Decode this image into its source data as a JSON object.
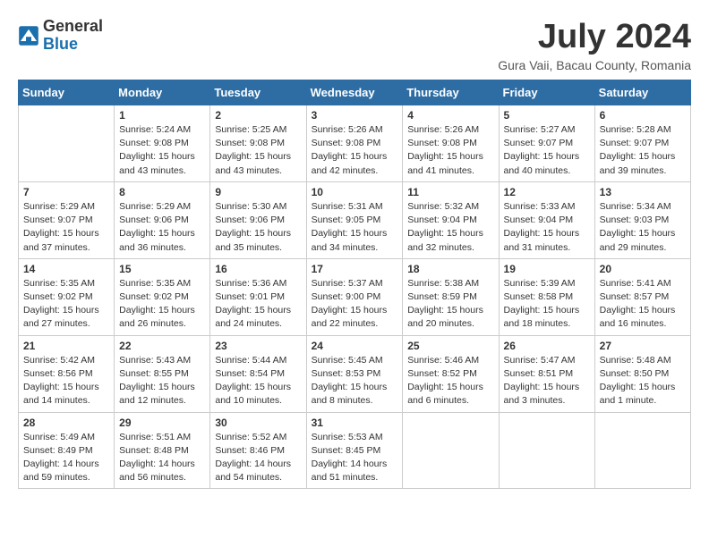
{
  "header": {
    "logo_general": "General",
    "logo_blue": "Blue",
    "month_title": "July 2024",
    "location": "Gura Vaii, Bacau County, Romania"
  },
  "weekdays": [
    "Sunday",
    "Monday",
    "Tuesday",
    "Wednesday",
    "Thursday",
    "Friday",
    "Saturday"
  ],
  "weeks": [
    [
      {
        "day": null,
        "info": null
      },
      {
        "day": "1",
        "info": "Sunrise: 5:24 AM\nSunset: 9:08 PM\nDaylight: 15 hours\nand 43 minutes."
      },
      {
        "day": "2",
        "info": "Sunrise: 5:25 AM\nSunset: 9:08 PM\nDaylight: 15 hours\nand 43 minutes."
      },
      {
        "day": "3",
        "info": "Sunrise: 5:26 AM\nSunset: 9:08 PM\nDaylight: 15 hours\nand 42 minutes."
      },
      {
        "day": "4",
        "info": "Sunrise: 5:26 AM\nSunset: 9:08 PM\nDaylight: 15 hours\nand 41 minutes."
      },
      {
        "day": "5",
        "info": "Sunrise: 5:27 AM\nSunset: 9:07 PM\nDaylight: 15 hours\nand 40 minutes."
      },
      {
        "day": "6",
        "info": "Sunrise: 5:28 AM\nSunset: 9:07 PM\nDaylight: 15 hours\nand 39 minutes."
      }
    ],
    [
      {
        "day": "7",
        "info": "Sunrise: 5:29 AM\nSunset: 9:07 PM\nDaylight: 15 hours\nand 37 minutes."
      },
      {
        "day": "8",
        "info": "Sunrise: 5:29 AM\nSunset: 9:06 PM\nDaylight: 15 hours\nand 36 minutes."
      },
      {
        "day": "9",
        "info": "Sunrise: 5:30 AM\nSunset: 9:06 PM\nDaylight: 15 hours\nand 35 minutes."
      },
      {
        "day": "10",
        "info": "Sunrise: 5:31 AM\nSunset: 9:05 PM\nDaylight: 15 hours\nand 34 minutes."
      },
      {
        "day": "11",
        "info": "Sunrise: 5:32 AM\nSunset: 9:04 PM\nDaylight: 15 hours\nand 32 minutes."
      },
      {
        "day": "12",
        "info": "Sunrise: 5:33 AM\nSunset: 9:04 PM\nDaylight: 15 hours\nand 31 minutes."
      },
      {
        "day": "13",
        "info": "Sunrise: 5:34 AM\nSunset: 9:03 PM\nDaylight: 15 hours\nand 29 minutes."
      }
    ],
    [
      {
        "day": "14",
        "info": "Sunrise: 5:35 AM\nSunset: 9:02 PM\nDaylight: 15 hours\nand 27 minutes."
      },
      {
        "day": "15",
        "info": "Sunrise: 5:35 AM\nSunset: 9:02 PM\nDaylight: 15 hours\nand 26 minutes."
      },
      {
        "day": "16",
        "info": "Sunrise: 5:36 AM\nSunset: 9:01 PM\nDaylight: 15 hours\nand 24 minutes."
      },
      {
        "day": "17",
        "info": "Sunrise: 5:37 AM\nSunset: 9:00 PM\nDaylight: 15 hours\nand 22 minutes."
      },
      {
        "day": "18",
        "info": "Sunrise: 5:38 AM\nSunset: 8:59 PM\nDaylight: 15 hours\nand 20 minutes."
      },
      {
        "day": "19",
        "info": "Sunrise: 5:39 AM\nSunset: 8:58 PM\nDaylight: 15 hours\nand 18 minutes."
      },
      {
        "day": "20",
        "info": "Sunrise: 5:41 AM\nSunset: 8:57 PM\nDaylight: 15 hours\nand 16 minutes."
      }
    ],
    [
      {
        "day": "21",
        "info": "Sunrise: 5:42 AM\nSunset: 8:56 PM\nDaylight: 15 hours\nand 14 minutes."
      },
      {
        "day": "22",
        "info": "Sunrise: 5:43 AM\nSunset: 8:55 PM\nDaylight: 15 hours\nand 12 minutes."
      },
      {
        "day": "23",
        "info": "Sunrise: 5:44 AM\nSunset: 8:54 PM\nDaylight: 15 hours\nand 10 minutes."
      },
      {
        "day": "24",
        "info": "Sunrise: 5:45 AM\nSunset: 8:53 PM\nDaylight: 15 hours\nand 8 minutes."
      },
      {
        "day": "25",
        "info": "Sunrise: 5:46 AM\nSunset: 8:52 PM\nDaylight: 15 hours\nand 6 minutes."
      },
      {
        "day": "26",
        "info": "Sunrise: 5:47 AM\nSunset: 8:51 PM\nDaylight: 15 hours\nand 3 minutes."
      },
      {
        "day": "27",
        "info": "Sunrise: 5:48 AM\nSunset: 8:50 PM\nDaylight: 15 hours\nand 1 minute."
      }
    ],
    [
      {
        "day": "28",
        "info": "Sunrise: 5:49 AM\nSunset: 8:49 PM\nDaylight: 14 hours\nand 59 minutes."
      },
      {
        "day": "29",
        "info": "Sunrise: 5:51 AM\nSunset: 8:48 PM\nDaylight: 14 hours\nand 56 minutes."
      },
      {
        "day": "30",
        "info": "Sunrise: 5:52 AM\nSunset: 8:46 PM\nDaylight: 14 hours\nand 54 minutes."
      },
      {
        "day": "31",
        "info": "Sunrise: 5:53 AM\nSunset: 8:45 PM\nDaylight: 14 hours\nand 51 minutes."
      },
      {
        "day": null,
        "info": null
      },
      {
        "day": null,
        "info": null
      },
      {
        "day": null,
        "info": null
      }
    ]
  ]
}
